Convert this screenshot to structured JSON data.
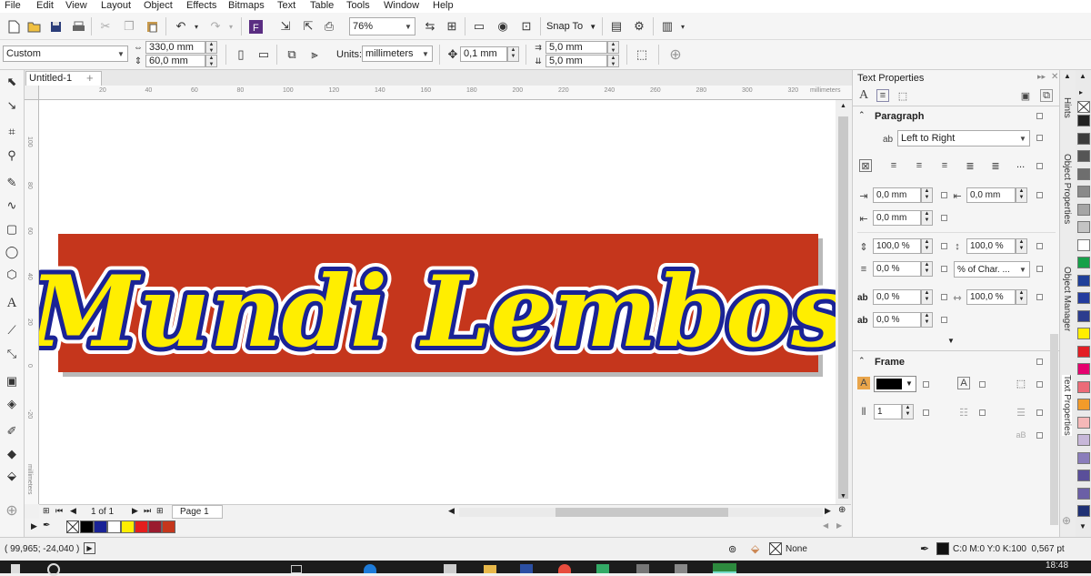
{
  "menu": [
    "File",
    "Edit",
    "View",
    "Layout",
    "Object",
    "Effects",
    "Bitmaps",
    "Text",
    "Table",
    "Tools",
    "Window",
    "Help"
  ],
  "standard_bar": {
    "zoom": "76%",
    "snap_to": "Snap To"
  },
  "property_bar": {
    "page_preset": "Custom",
    "width": "330,0 mm",
    "height": "60,0 mm",
    "units_label": "Units:",
    "units": "millimeters",
    "nudge": "0,1 mm",
    "dup_x": "5,0 mm",
    "dup_y": "5,0 mm"
  },
  "document": {
    "tab_title": "Untitled-1",
    "ruler_unit": "millimeters",
    "h_ruler_labels": [
      "20",
      "40",
      "60",
      "80",
      "100",
      "120",
      "140",
      "160",
      "180",
      "200",
      "220",
      "240",
      "260",
      "280",
      "300",
      "320"
    ],
    "v_ruler_labels": [
      "100",
      "80",
      "60",
      "40",
      "20",
      "0",
      "-20"
    ],
    "artwork_text": "Mundi Lembos",
    "artwork_bg": "#c5361c",
    "artwork_fill": "#ffee00",
    "artwork_outline": "#1a2396"
  },
  "page_nav": {
    "counter": "1 of 1",
    "page_tab": "Page 1"
  },
  "doc_palette": [
    "#000000",
    "#1a2396",
    "#ffffff",
    "#ffee00",
    "#e41e1e",
    "#9a1b2e",
    "#c5361c"
  ],
  "status": {
    "coords": "( 99,965; -24,040 )",
    "fill_label": "None",
    "outline_info": "C:0 M:0 Y:0 K:100  0,567 pt"
  },
  "taskbar": {
    "time": "18:48"
  },
  "text_properties": {
    "title": "Text Properties",
    "paragraph": {
      "heading": "Paragraph",
      "direction": "Left to Right",
      "left_indent": "0,0 mm",
      "right_indent": "0,0 mm",
      "first_line_indent": "0,0 mm",
      "line_spacing": "100,0 %",
      "char_spacing": "100,0 %",
      "before_para": "0,0 %",
      "spacing_unit": "% of Char. ...",
      "language_spacing": "0,0 %",
      "word_spacing": "100,0 %",
      "after_para": "0,0 %",
      "more": "..."
    },
    "frame": {
      "heading": "Frame",
      "bg_color": "#000000",
      "columns": "1"
    }
  },
  "docker_tabs": [
    "Hints",
    "Object Properties",
    "Object Manager",
    "Text Properties"
  ],
  "color_palette": [
    "#222222",
    "#3c3c3c",
    "#555555",
    "#6e6e6e",
    "#8a8a8a",
    "#a5a5a5",
    "#c4c4c4",
    "#ffffff",
    "#16a049",
    "#1f3f99",
    "#233b9e",
    "#2c3d8e",
    "#ffee00",
    "#e31e24",
    "#e5006e",
    "#ec6b78",
    "#f29b2a",
    "#f5b8b8",
    "#c7b7d9",
    "#8a7dbb",
    "#5a4f9a",
    "#6b5fa6",
    "#1f3074"
  ]
}
